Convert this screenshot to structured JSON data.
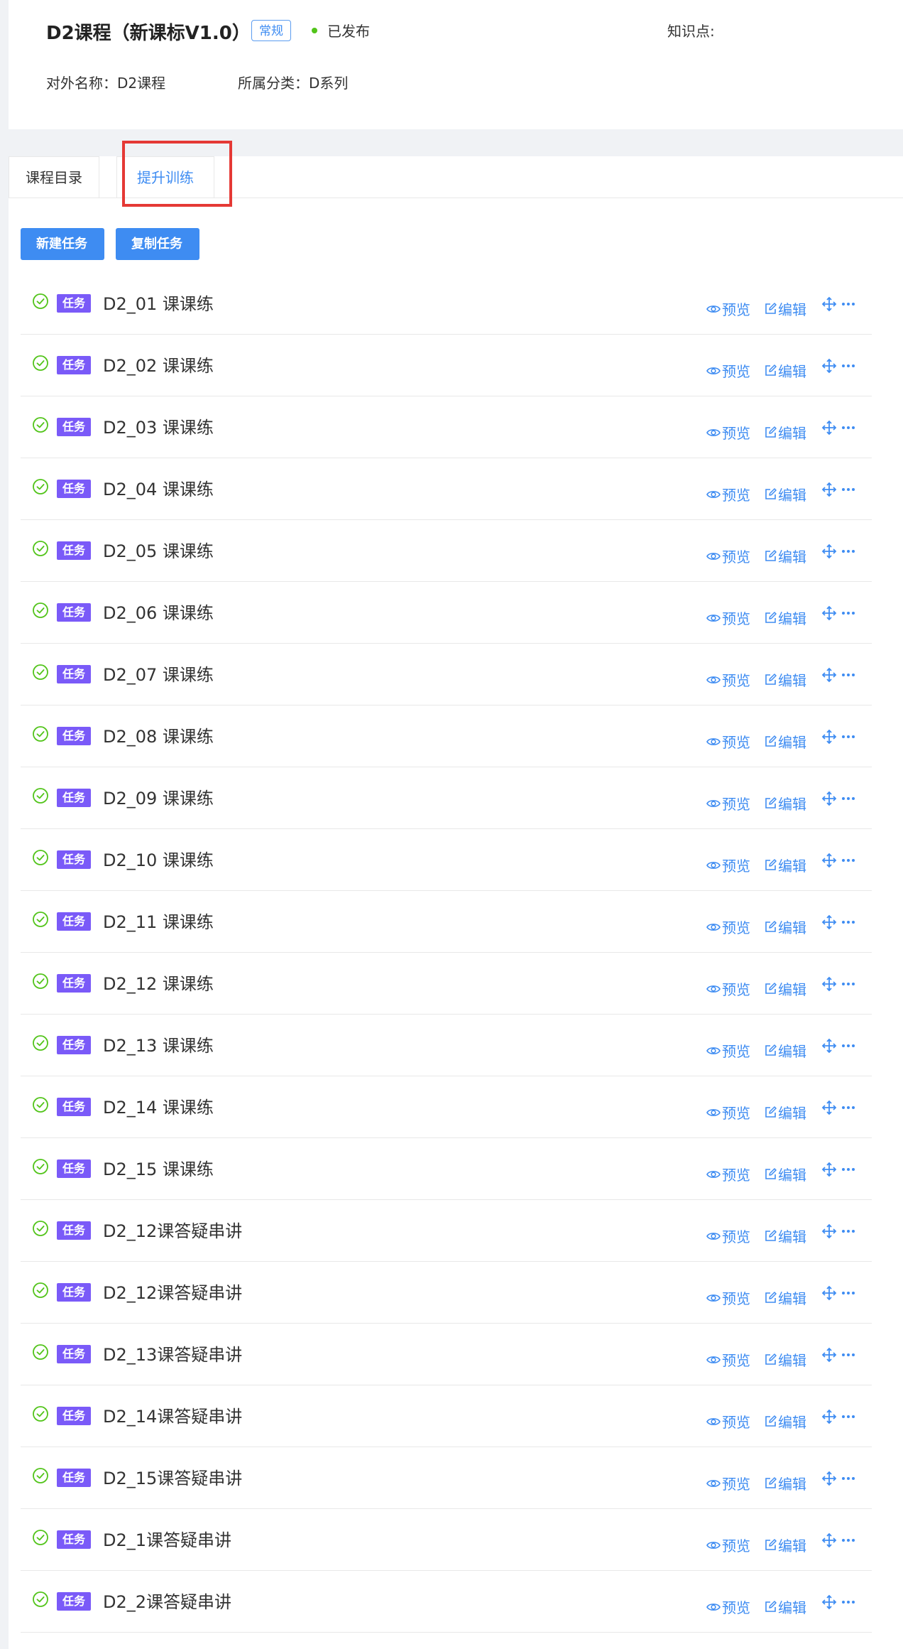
{
  "header": {
    "title": "D2课程（新课标V1.0）",
    "type_tag": "常规",
    "status": "已发布",
    "knowledge_label": "知识点:",
    "external_name": "对外名称：D2课程",
    "category": "所属分类：D系列"
  },
  "tabs": [
    {
      "label": "课程目录",
      "active": false
    },
    {
      "label": "提升训练",
      "active": true
    }
  ],
  "toolbar": {
    "new_task": "新建任务",
    "copy_task": "复制任务"
  },
  "task_badge": "任务",
  "actions": {
    "preview": "预览",
    "edit": "编辑"
  },
  "tasks": [
    "D2_01 课课练",
    "D2_02 课课练",
    "D2_03 课课练",
    "D2_04 课课练",
    "D2_05 课课练",
    "D2_06 课课练",
    "D2_07 课课练",
    "D2_08 课课练",
    "D2_09 课课练",
    "D2_10 课课练",
    "D2_11 课课练",
    "D2_12 课课练",
    "D2_13 课课练",
    "D2_14 课课练",
    "D2_15 课课练",
    "D2_12课答疑串讲",
    "D2_12课答疑串讲",
    "D2_13课答疑串讲",
    "D2_14课答疑串讲",
    "D2_15课答疑串讲",
    "D2_1课答疑串讲",
    "D2_2课答疑串讲"
  ],
  "colors": {
    "accent": "#3e8cf2",
    "badge": "#7a5af8",
    "success": "#52c41a",
    "highlight": "#e53935"
  }
}
